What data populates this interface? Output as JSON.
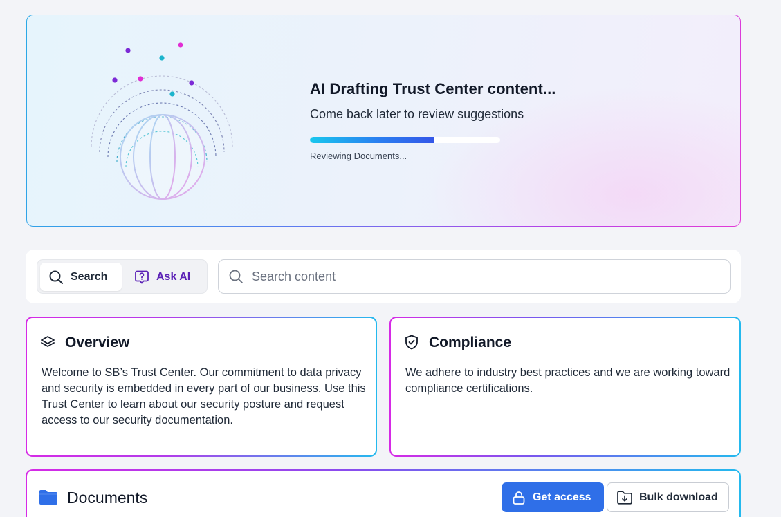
{
  "banner": {
    "title": "AI Drafting Trust Center content...",
    "subtitle": "Come back later to review suggestions",
    "progress": 0.65,
    "status": "Reviewing Documents..."
  },
  "search": {
    "mode_search_label": "Search",
    "mode_ai_label": "Ask AI",
    "placeholder": "Search content",
    "value": ""
  },
  "overview": {
    "title": "Overview",
    "body": "Welcome to SB’s Trust Center. Our commitment to data privacy and security is embedded in every part of our business. Use this Trust Center to learn about our security posture and request access to our security documentation."
  },
  "compliance": {
    "title": "Compliance",
    "body": "We adhere to industry best practices and we are working toward compliance certifications."
  },
  "documents": {
    "title": "Documents",
    "get_access_label": "Get access",
    "bulk_download_label": "Bulk download"
  },
  "colors": {
    "accent_blue": "#2f6fe8",
    "accent_purple": "#5b21b6",
    "gradient_pink": "#d62ae6",
    "gradient_cyan": "#24b9ee"
  },
  "icons": {
    "search_mode": "search-icon",
    "ask_ai": "question-bubble-icon",
    "search_input": "search-icon",
    "overview": "layers-icon",
    "compliance": "shield-check-icon",
    "documents": "folder-icon",
    "get_access": "lock-icon",
    "bulk_download": "folder-download-icon"
  }
}
